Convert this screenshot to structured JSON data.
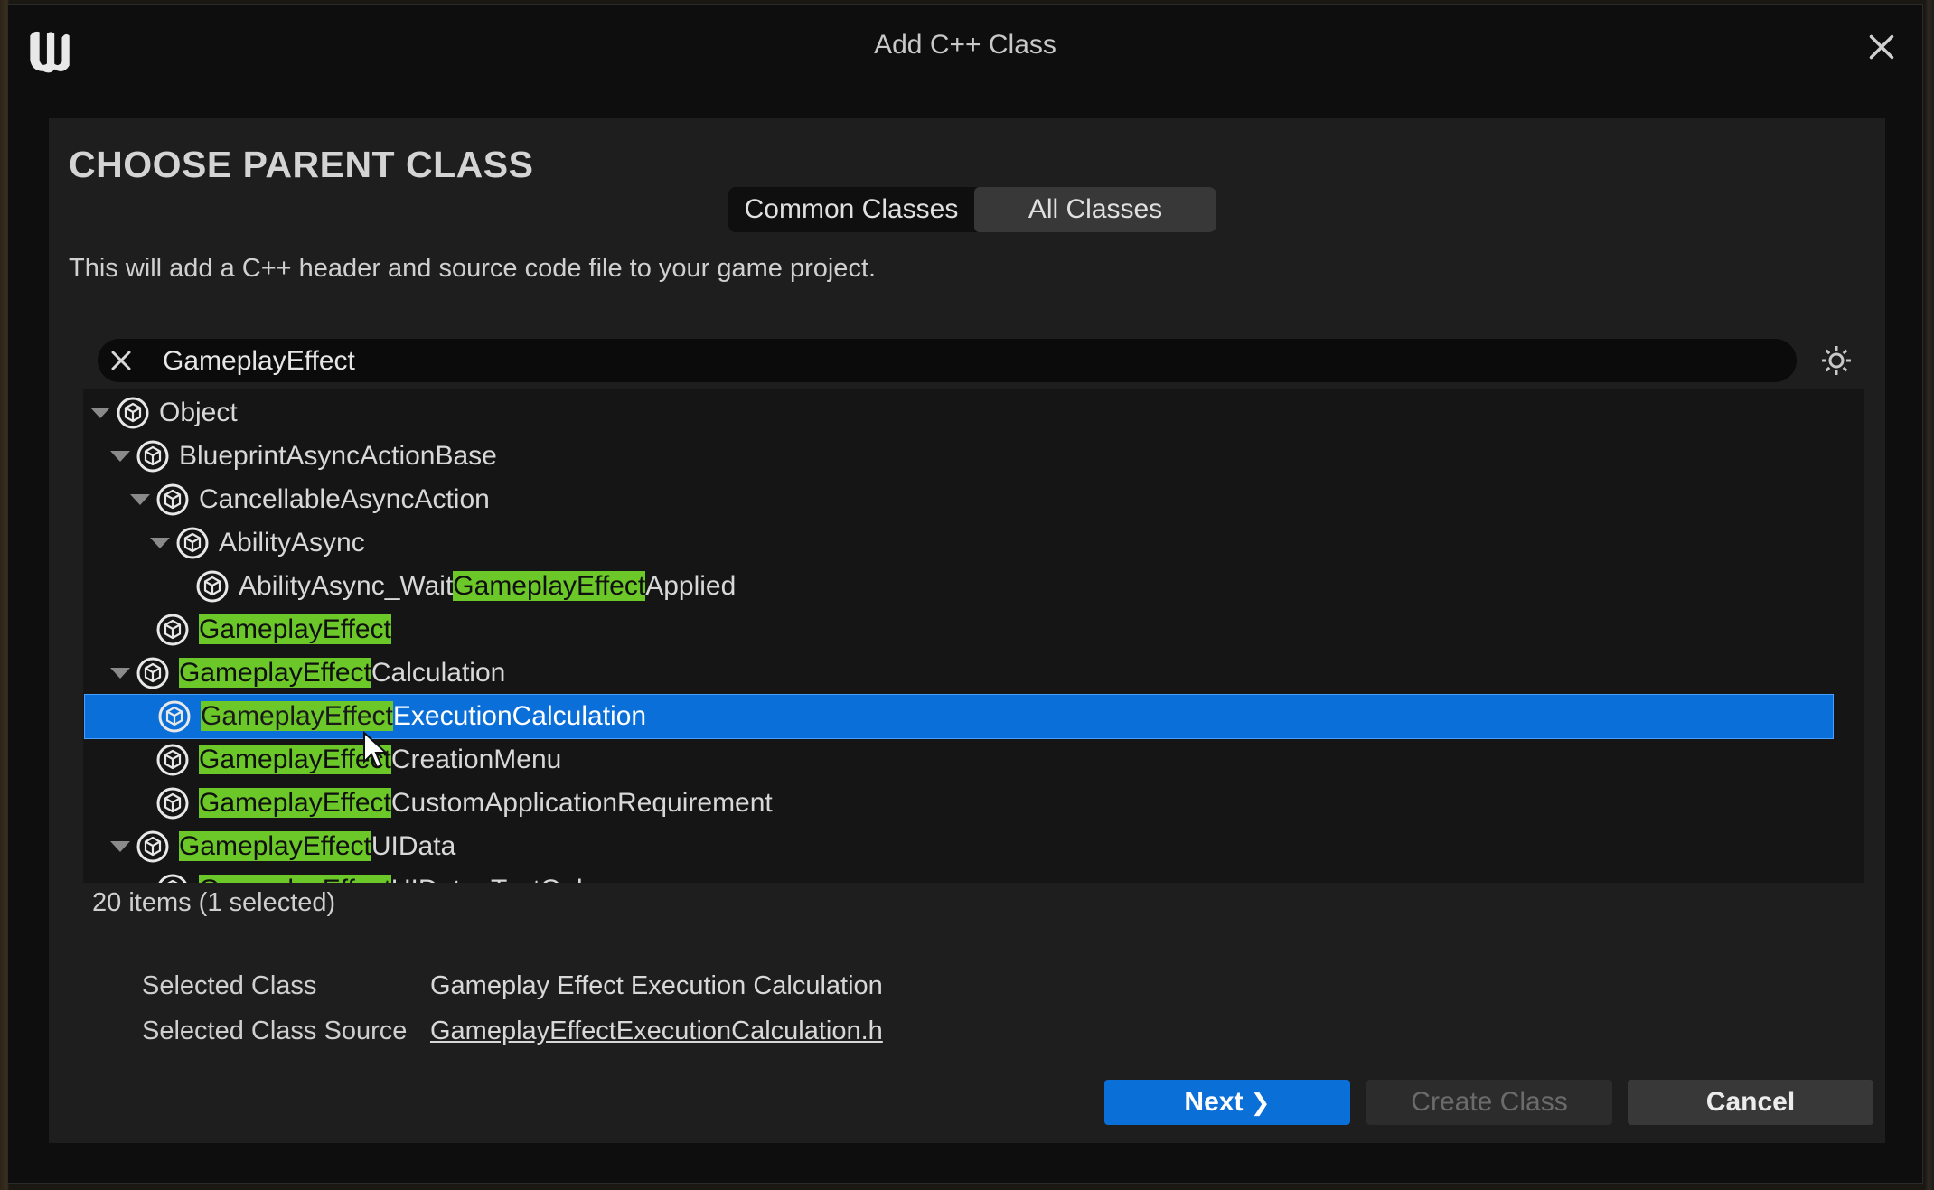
{
  "window": {
    "title": "Add C++ Class",
    "logo_icon": "unreal-engine-logo",
    "close_icon": "close-icon"
  },
  "page": {
    "heading": "CHOOSE PARENT CLASS",
    "tabs": [
      {
        "label": "Common Classes",
        "active": false
      },
      {
        "label": "All Classes",
        "active": true
      }
    ],
    "description": "This will add a C++ header and source code file to your game project."
  },
  "search": {
    "value": "GameplayEffect",
    "placeholder": "",
    "clear_icon": "clear-x-icon",
    "settings_icon": "gear-icon"
  },
  "tree": {
    "rows": [
      {
        "pre": "Object",
        "hl": "",
        "post": "",
        "expanded": true
      },
      {
        "pre": "BlueprintAsyncActionBase",
        "hl": "",
        "post": "",
        "expanded": true
      },
      {
        "pre": "CancellableAsyncAction",
        "hl": "",
        "post": "",
        "expanded": true
      },
      {
        "pre": "AbilityAsync",
        "hl": "",
        "post": "",
        "expanded": true
      },
      {
        "pre": "AbilityAsync_Wait",
        "hl": "GameplayEffect",
        "post": "Applied",
        "expanded": false
      },
      {
        "pre": "",
        "hl": "GameplayEffect",
        "post": "",
        "expanded": false
      },
      {
        "pre": "",
        "hl": "GameplayEffect",
        "post": "Calculation",
        "expanded": true
      },
      {
        "pre": "",
        "hl": "GameplayEffect",
        "post": "ExecutionCalculation",
        "expanded": false,
        "selected": true
      },
      {
        "pre": "",
        "hl": "GameplayEffect",
        "post": "CreationMenu",
        "expanded": false
      },
      {
        "pre": "",
        "hl": "GameplayEffect",
        "post": "CustomApplicationRequirement",
        "expanded": false
      },
      {
        "pre": "",
        "hl": "GameplayEffect",
        "post": "UIData",
        "expanded": true
      },
      {
        "pre": "",
        "hl": "GameplayEffect",
        "post": "UIData_TextOnly",
        "expanded": false
      }
    ],
    "item_icon": "class-cube-icon"
  },
  "status": {
    "count": "20 items (1 selected)"
  },
  "details": {
    "selected_class_label": "Selected Class",
    "selected_class_value": "Gameplay Effect Execution Calculation",
    "selected_source_label": "Selected Class Source",
    "selected_source_value": "GameplayEffectExecutionCalculation.h"
  },
  "buttons": {
    "next": "Next",
    "create": "Create Class",
    "cancel": "Cancel"
  },
  "colors": {
    "selection": "#0a6fd8",
    "search_highlight": "#6bc828",
    "primary_button": "#0b6fd8"
  }
}
